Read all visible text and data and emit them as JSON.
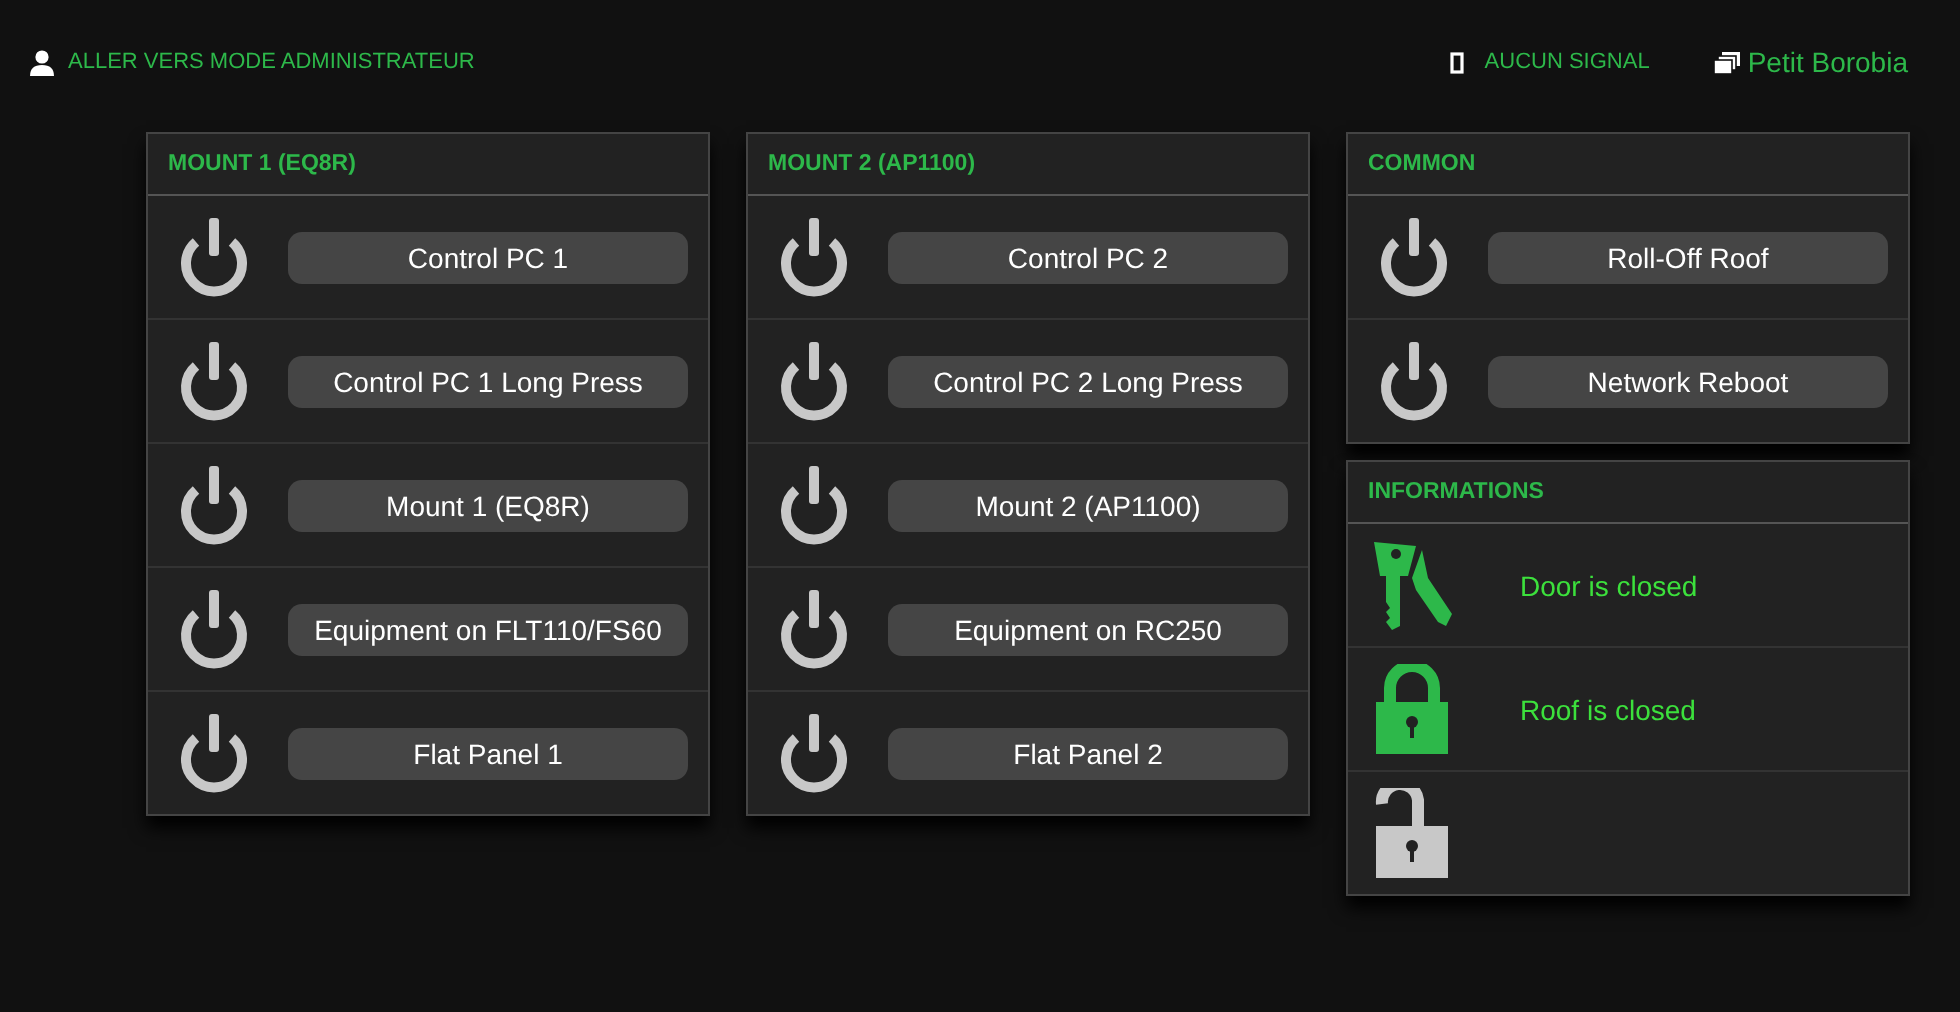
{
  "top_bar": {
    "admin_link": "ALLER VERS MODE ADMINISTRATEUR",
    "signal": "AUCUN SIGNAL",
    "site": "Petit Borobia"
  },
  "panels": [
    {
      "title": "MOUNT 1 (EQ8R)",
      "switches": [
        {
          "label": "Control PC 1",
          "on": false
        },
        {
          "label": "Control PC 1 Long Press",
          "on": false
        },
        {
          "label": "Mount 1 (EQ8R)",
          "on": false
        },
        {
          "label": "Equipment on FLT110/FS60",
          "on": false
        },
        {
          "label": "Flat Panel 1",
          "on": false
        }
      ]
    },
    {
      "title": "MOUNT 2 (AP1100)",
      "switches": [
        {
          "label": "Control PC 2",
          "on": false
        },
        {
          "label": "Control PC 2 Long Press",
          "on": false
        },
        {
          "label": "Mount 2 (AP1100)",
          "on": false
        },
        {
          "label": "Equipment on RC250",
          "on": false
        },
        {
          "label": "Flat Panel 2",
          "on": false
        }
      ]
    },
    {
      "title": "COMMON",
      "switches": [
        {
          "label": "Roll-Off Roof",
          "on": false
        },
        {
          "label": "Network Reboot",
          "on": false
        }
      ]
    }
  ],
  "informations": {
    "title": "INFORMATIONS",
    "items": [
      {
        "kind": "keys",
        "active": true,
        "text": "Door is closed"
      },
      {
        "kind": "lock-closed",
        "active": true,
        "text": "Roof is closed"
      },
      {
        "kind": "lock-open",
        "active": false
      }
    ]
  }
}
